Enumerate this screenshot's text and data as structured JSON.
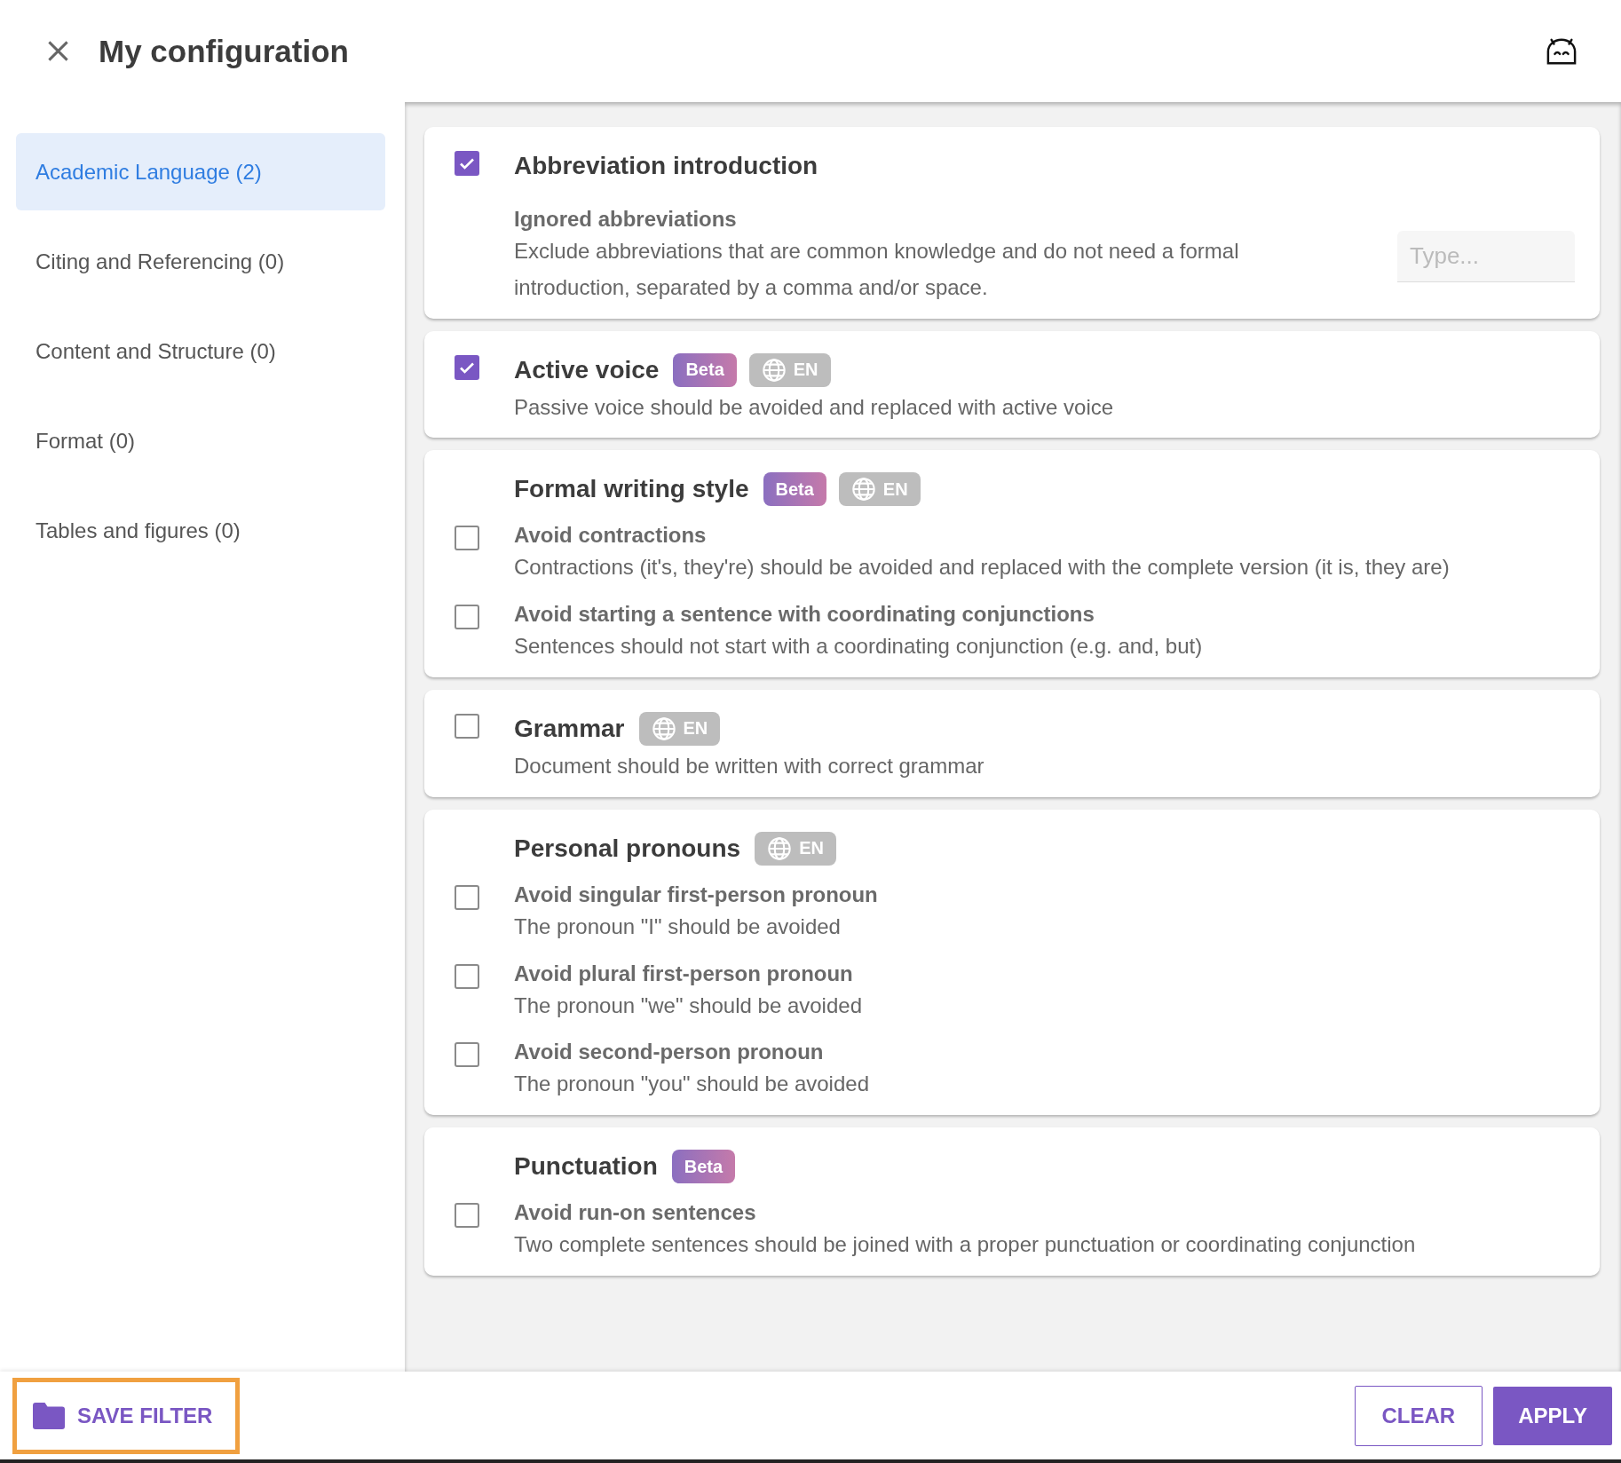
{
  "header": {
    "title": "My configuration"
  },
  "sidebar": {
    "items": [
      {
        "label": "Academic Language (2)",
        "selected": true
      },
      {
        "label": "Citing and Referencing (0)",
        "selected": false
      },
      {
        "label": "Content and Structure (0)",
        "selected": false
      },
      {
        "label": "Format (0)",
        "selected": false
      },
      {
        "label": "Tables and figures (0)",
        "selected": false
      }
    ]
  },
  "rules": [
    {
      "title": "Abbreviation introduction",
      "checked": true,
      "setting": {
        "label": "Ignored abbreviations",
        "description": "Exclude abbreviations that are common knowledge and do not need a formal introduction, separated by a comma and/or space.",
        "placeholder": "Type..."
      }
    },
    {
      "title": "Active voice",
      "checked": true,
      "badges": [
        {
          "kind": "beta",
          "label": "Beta"
        },
        {
          "kind": "language",
          "label": "EN"
        }
      ],
      "description": "Passive voice should be avoided and replaced with active voice"
    },
    {
      "title": "Formal writing style",
      "badges": [
        {
          "kind": "beta",
          "label": "Beta"
        },
        {
          "kind": "language",
          "label": "EN"
        }
      ],
      "options": [
        {
          "label": "Avoid contractions",
          "description": "Contractions (it's, they're) should be avoided and replaced with the complete version (it is, they are)",
          "checked": false
        },
        {
          "label": "Avoid starting a sentence with coordinating conjunctions",
          "description": "Sentences should not start with a coordinating conjunction (e.g. and, but)",
          "checked": false
        }
      ]
    },
    {
      "title": "Grammar",
      "checked": false,
      "badges": [
        {
          "kind": "language",
          "label": "EN"
        }
      ],
      "description": "Document should be written with correct grammar"
    },
    {
      "title": "Personal pronouns",
      "badges": [
        {
          "kind": "language",
          "label": "EN"
        }
      ],
      "options": [
        {
          "label": "Avoid singular first-person pronoun",
          "description": "The pronoun \"I\" should be avoided",
          "checked": false
        },
        {
          "label": "Avoid plural first-person pronoun",
          "description": "The pronoun \"we\" should be avoided",
          "checked": false
        },
        {
          "label": "Avoid second-person pronoun",
          "description": "The pronoun \"you\" should be avoided",
          "checked": false
        }
      ]
    },
    {
      "title": "Punctuation",
      "badges": [
        {
          "kind": "beta",
          "label": "Beta"
        }
      ],
      "options": [
        {
          "label": "Avoid run-on sentences",
          "description": "Two complete sentences should be joined with a proper punctuation or coordinating conjunction",
          "checked": false
        }
      ]
    }
  ],
  "footer": {
    "save": "SAVE FILTER",
    "clear": "CLEAR",
    "apply": "APPLY"
  }
}
